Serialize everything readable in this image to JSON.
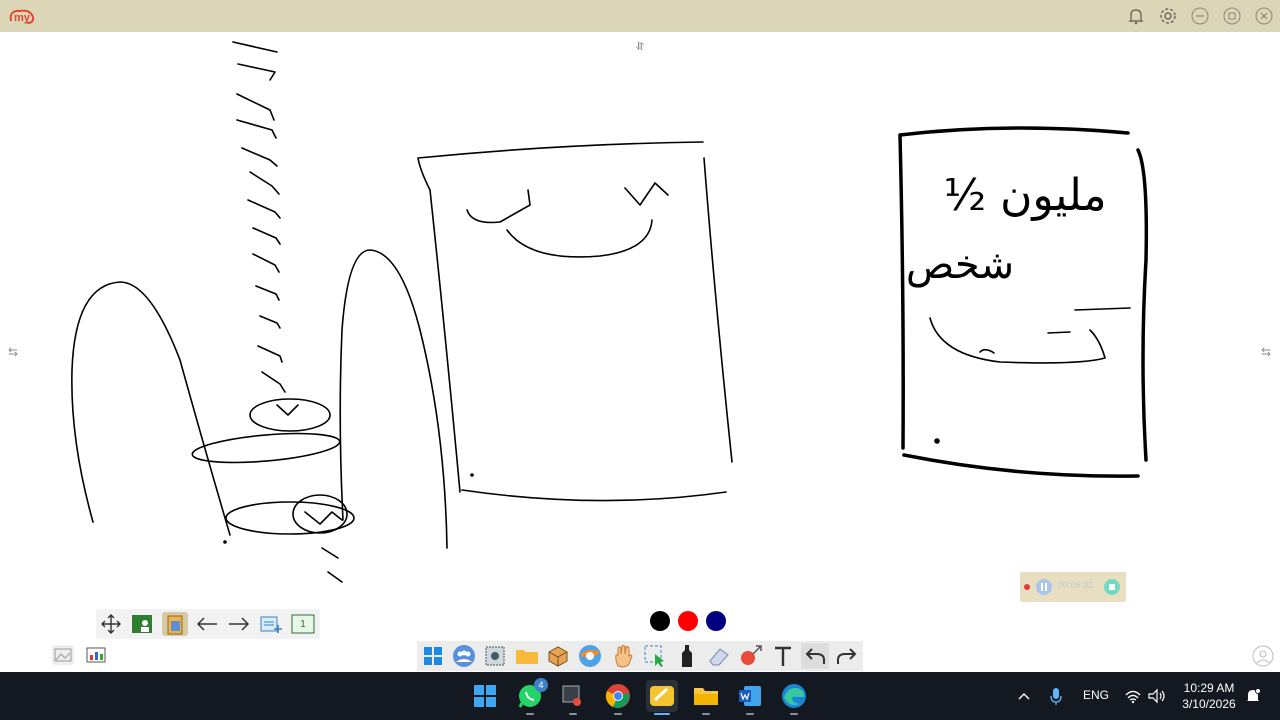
{
  "app": {
    "logo_text": "my"
  },
  "window_controls": [
    "bell-icon",
    "gear-icon",
    "minimize-icon",
    "restore-icon",
    "close-icon"
  ],
  "canvas": {
    "background": "#ffffff",
    "pen_color": "#000000"
  },
  "sketch_text": {
    "right_box_line1": "½ مليون",
    "right_box_line2": "شخص",
    "top_center_glyph": "⥯"
  },
  "page_toolbar": {
    "items": [
      "move-icon",
      "board-icon",
      "clipboard-icon",
      "arrow-left-icon",
      "arrow-right-icon",
      "add-page-icon",
      "page-icon"
    ],
    "page_number": "1"
  },
  "pen_colors": [
    "#000000",
    "#ff0000",
    "#000080"
  ],
  "drawing_tools": [
    "windows-icon",
    "people-icon",
    "screenshot-icon",
    "folder-icon",
    "box-icon",
    "browser-icon",
    "hand-icon",
    "select-icon",
    "marker-icon",
    "eraser-icon",
    "shapes-icon",
    "text-icon",
    "undo-icon",
    "redo-icon"
  ],
  "recorder": {
    "time": "00:06:32"
  },
  "taskbar": {
    "apps": [
      "windows-start-icon",
      "whatsapp-icon",
      "snipping-icon",
      "chrome-icon",
      "whiteboard-icon",
      "file-explorer-icon",
      "word-icon",
      "edge-icon"
    ],
    "whatsapp_badge": "4",
    "language": "ENG",
    "time": "10:29 AM",
    "date": "3/10/2026"
  }
}
